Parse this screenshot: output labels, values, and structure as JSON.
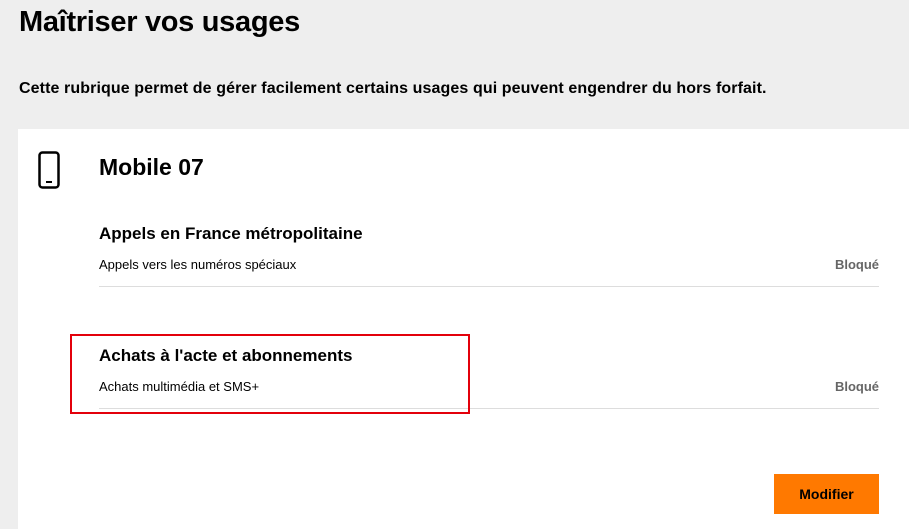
{
  "page": {
    "title": "Maîtriser vos usages",
    "intro": "Cette rubrique permet de gérer facilement certains usages qui peuvent engendrer du hors forfait."
  },
  "card": {
    "icon": "mobile-phone-icon",
    "line_name": "Mobile 07",
    "sections": [
      {
        "title": "Appels en France métropolitaine",
        "label": "Appels vers les numéros spéciaux",
        "status": "Bloqué"
      },
      {
        "title": "Achats à l'acte et abonnements",
        "label": "Achats multimédia et SMS+",
        "status": "Bloqué"
      }
    ],
    "modify_label": "Modifier"
  },
  "colors": {
    "accent": "#ff7900",
    "highlight": "#e3000b",
    "status": "#666666"
  }
}
